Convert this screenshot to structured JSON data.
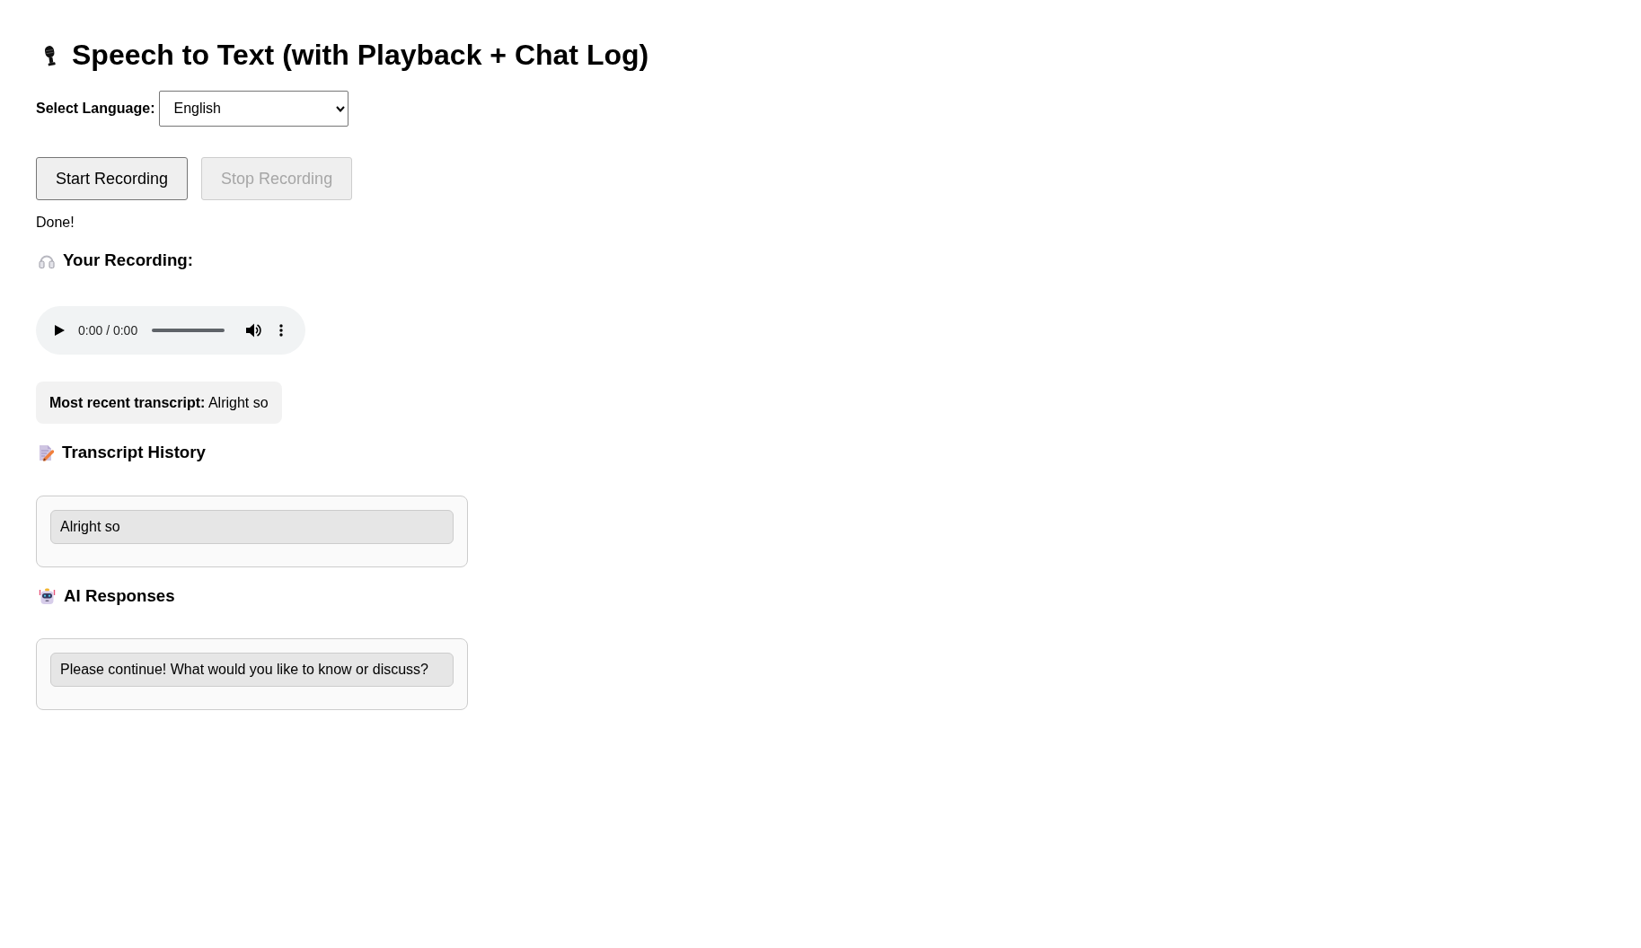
{
  "title": "Speech to Text (with Playback + Chat Log)",
  "language": {
    "label": "Select Language:",
    "value": "English"
  },
  "buttons": [
    {
      "label": "Start Recording",
      "disabled": false
    },
    {
      "label": "Stop Recording",
      "disabled": true
    }
  ],
  "status": "Done!",
  "recording": {
    "heading": "Your Recording:",
    "player": {
      "time": "0:00 / 0:00",
      "progress": {
        "level": 0
      }
    }
  },
  "latest_transcript": "**Most recent transcript:** Alright so",
  "transcript_history": {
    "heading": "Transcript History",
    "items": [
      "Alright so"
    ]
  },
  "ai_responses": {
    "heading": "AI Responses",
    "items": [
      "Please continue! What would you like to know or discuss?"
    ]
  }
}
